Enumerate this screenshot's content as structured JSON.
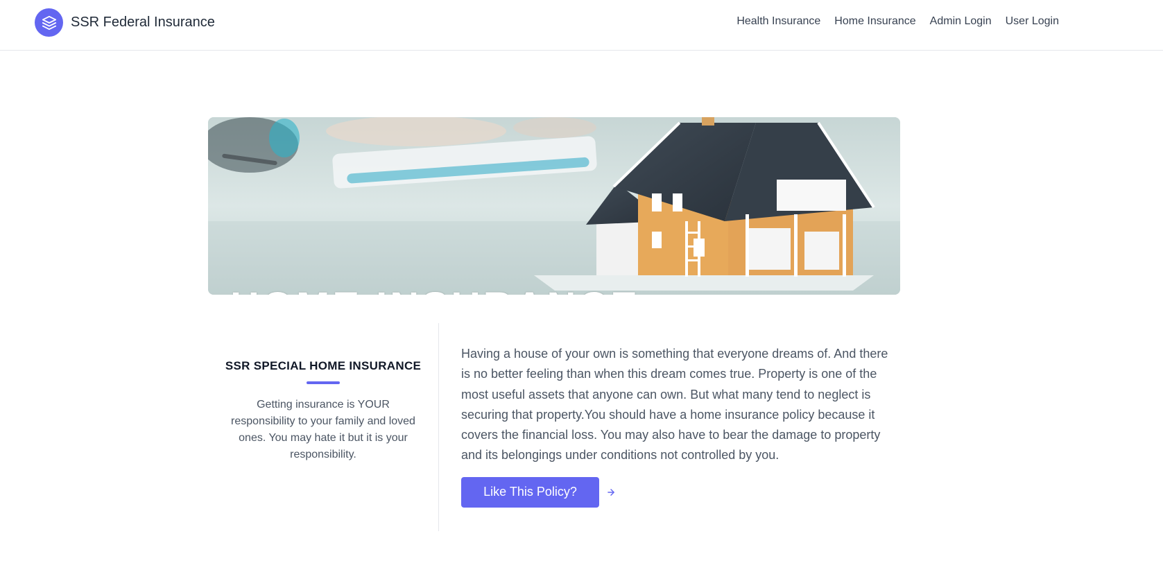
{
  "header": {
    "brand_name": "SSR Federal Insurance",
    "logo_icon": "stacked-layers-icon",
    "nav": [
      {
        "label": "Health Insurance"
      },
      {
        "label": "Home Insurance"
      },
      {
        "label": "Admin Login"
      },
      {
        "label": "User Login"
      }
    ]
  },
  "hero": {
    "caption": "HOME INSURANCE",
    "image_subject": "house-model-on-desk"
  },
  "left": {
    "title": "SSR SPECIAL HOME INSURANCE",
    "text": "Getting insurance is YOUR responsibility to your family and loved ones. You may hate it but it is your responsibility."
  },
  "right": {
    "body": "Having a house of your own is something that everyone dreams of. And there is no better feeling than when this dream comes true. Property is one of the most useful assets that anyone can own. But what many tend to neglect is securing that property.You should have a home insurance policy because it covers the financial loss. You may also have to bear the damage to property and its belongings under conditions not controlled by you.",
    "cta_label": "Like This Policy?",
    "cta_icon": "arrow-right-icon"
  },
  "colors": {
    "accent": "#6366f1",
    "text": "#4b5563",
    "heading": "#111827"
  }
}
